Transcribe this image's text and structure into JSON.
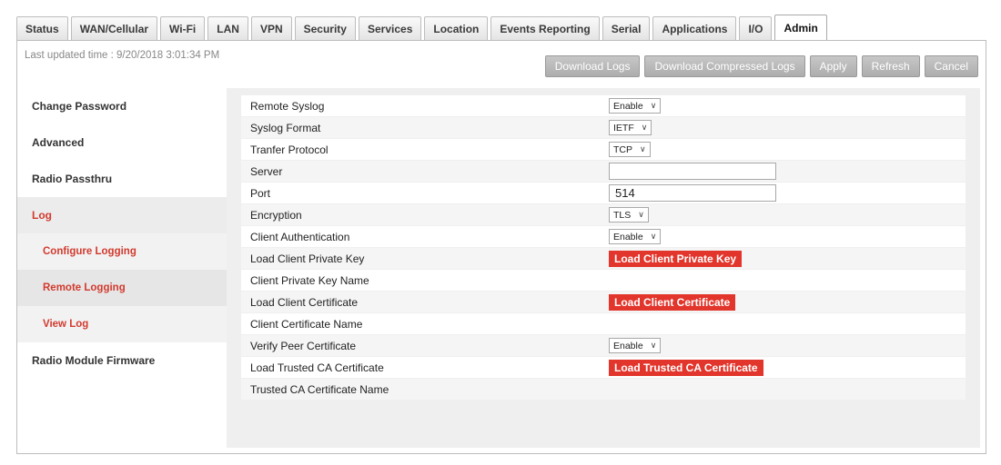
{
  "tabs": [
    "Status",
    "WAN/Cellular",
    "Wi-Fi",
    "LAN",
    "VPN",
    "Security",
    "Services",
    "Location",
    "Events Reporting",
    "Serial",
    "Applications",
    "I/O",
    "Admin"
  ],
  "active_tab": "Admin",
  "last_updated": "Last updated time : 9/20/2018 3:01:34 PM",
  "actions": {
    "download_logs": "Download Logs",
    "download_compressed": "Download Compressed Logs",
    "apply": "Apply",
    "refresh": "Refresh",
    "cancel": "Cancel"
  },
  "sidebar": {
    "items": [
      "Change Password",
      "Advanced",
      "Radio Passthru",
      "Log"
    ],
    "sub_items": [
      "Configure Logging",
      "Remote Logging",
      "View Log"
    ],
    "last_item": "Radio Module Firmware"
  },
  "form": {
    "remote_syslog": {
      "label": "Remote Syslog",
      "value": "Enable"
    },
    "syslog_format": {
      "label": "Syslog Format",
      "value": "IETF"
    },
    "transfer_protocol": {
      "label": "Tranfer Protocol",
      "value": "TCP"
    },
    "server": {
      "label": "Server",
      "value": ""
    },
    "port": {
      "label": "Port",
      "value": "514"
    },
    "encryption": {
      "label": "Encryption",
      "value": "TLS"
    },
    "client_auth": {
      "label": "Client Authentication",
      "value": "Enable"
    },
    "load_client_key": {
      "label": "Load Client Private Key",
      "button": "Load Client Private Key"
    },
    "client_key_name": {
      "label": "Client Private Key Name"
    },
    "load_client_cert": {
      "label": "Load Client Certificate",
      "button": "Load Client Certificate"
    },
    "client_cert_name": {
      "label": "Client Certificate Name"
    },
    "verify_peer": {
      "label": "Verify Peer Certificate",
      "value": "Enable"
    },
    "load_ca_cert": {
      "label": "Load Trusted CA Certificate",
      "button": "Load Trusted CA Certificate"
    },
    "ca_cert_name": {
      "label": "Trusted CA Certificate Name"
    }
  },
  "colors": {
    "accent": "#e2352b",
    "link": "#d23a2e"
  }
}
